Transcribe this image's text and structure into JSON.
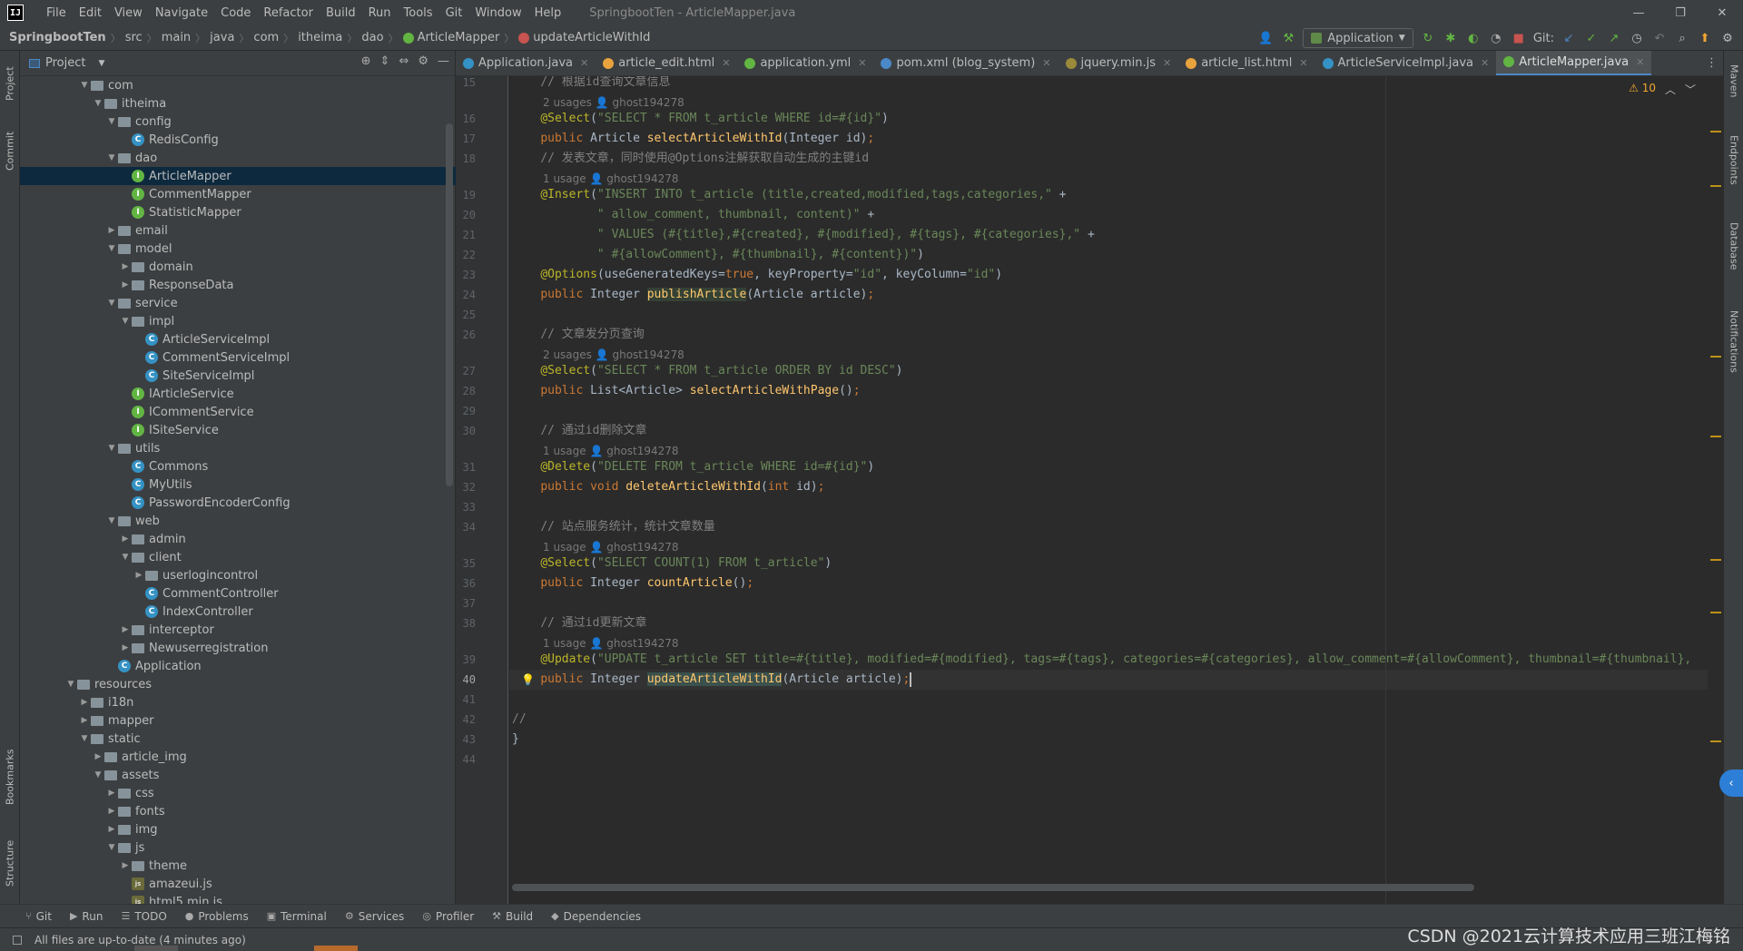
{
  "app": {
    "logo": "IJ",
    "window_title": "SpringbootTen - ArticleMapper.java",
    "menu": [
      "File",
      "Edit",
      "View",
      "Navigate",
      "Code",
      "Refactor",
      "Build",
      "Run",
      "Tools",
      "Git",
      "Window",
      "Help"
    ],
    "window_controls": [
      "—",
      "❐",
      "✕"
    ]
  },
  "navbar": {
    "breadcrumb": [
      "SpringbootTen",
      "src",
      "main",
      "java",
      "com",
      "itheima",
      "dao",
      "ArticleMapper",
      "updateArticleWithId"
    ],
    "run_config": "Application",
    "git_label": "Git:"
  },
  "left_strip": {
    "tabs": [
      "Project",
      "Commit",
      "Bookmarks",
      "Structure"
    ]
  },
  "right_strip": {
    "tabs": [
      "Maven",
      "Endpoints",
      "Database",
      "Notifications"
    ]
  },
  "project_panel": {
    "title": "Project",
    "tree": [
      {
        "depth": 0,
        "label": "com",
        "type": "folder",
        "open": true
      },
      {
        "depth": 1,
        "label": "itheima",
        "type": "folder",
        "open": true
      },
      {
        "depth": 2,
        "label": "config",
        "type": "folder",
        "open": true
      },
      {
        "depth": 3,
        "label": "RedisConfig",
        "type": "class"
      },
      {
        "depth": 2,
        "label": "dao",
        "type": "folder",
        "open": true
      },
      {
        "depth": 3,
        "label": "ArticleMapper",
        "type": "interface",
        "selected": true
      },
      {
        "depth": 3,
        "label": "CommentMapper",
        "type": "interface"
      },
      {
        "depth": 3,
        "label": "StatisticMapper",
        "type": "interface"
      },
      {
        "depth": 2,
        "label": "email",
        "type": "folder",
        "open": false
      },
      {
        "depth": 2,
        "label": "model",
        "type": "folder",
        "open": true
      },
      {
        "depth": 3,
        "label": "domain",
        "type": "folder",
        "open": false
      },
      {
        "depth": 3,
        "label": "ResponseData",
        "type": "folder",
        "open": false
      },
      {
        "depth": 2,
        "label": "service",
        "type": "folder",
        "open": true
      },
      {
        "depth": 3,
        "label": "impl",
        "type": "folder",
        "open": true
      },
      {
        "depth": 4,
        "label": "ArticleServiceImpl",
        "type": "class"
      },
      {
        "depth": 4,
        "label": "CommentServiceImpl",
        "type": "class"
      },
      {
        "depth": 4,
        "label": "SiteServiceImpl",
        "type": "class"
      },
      {
        "depth": 3,
        "label": "IArticleService",
        "type": "interface"
      },
      {
        "depth": 3,
        "label": "ICommentService",
        "type": "interface"
      },
      {
        "depth": 3,
        "label": "ISiteService",
        "type": "interface"
      },
      {
        "depth": 2,
        "label": "utils",
        "type": "folder",
        "open": true
      },
      {
        "depth": 3,
        "label": "Commons",
        "type": "class"
      },
      {
        "depth": 3,
        "label": "MyUtils",
        "type": "class"
      },
      {
        "depth": 3,
        "label": "PasswordEncoderConfig",
        "type": "class"
      },
      {
        "depth": 2,
        "label": "web",
        "type": "folder",
        "open": true
      },
      {
        "depth": 3,
        "label": "admin",
        "type": "folder",
        "open": false
      },
      {
        "depth": 3,
        "label": "client",
        "type": "folder",
        "open": true
      },
      {
        "depth": 4,
        "label": "userlogincontrol",
        "type": "folder",
        "open": false
      },
      {
        "depth": 4,
        "label": "CommentController",
        "type": "class"
      },
      {
        "depth": 4,
        "label": "IndexController",
        "type": "class"
      },
      {
        "depth": 3,
        "label": "interceptor",
        "type": "folder",
        "open": false
      },
      {
        "depth": 3,
        "label": "Newuserregistration",
        "type": "folder",
        "open": false
      },
      {
        "depth": 2,
        "label": "Application",
        "type": "app"
      },
      {
        "depth": -1,
        "label": "resources",
        "type": "folder",
        "open": true
      },
      {
        "depth": 0,
        "label": "i18n",
        "type": "folder",
        "open": false
      },
      {
        "depth": 0,
        "label": "mapper",
        "type": "folder",
        "open": false
      },
      {
        "depth": 0,
        "label": "static",
        "type": "folder",
        "open": true
      },
      {
        "depth": 1,
        "label": "article_img",
        "type": "folder",
        "open": false
      },
      {
        "depth": 1,
        "label": "assets",
        "type": "folder",
        "open": true
      },
      {
        "depth": 2,
        "label": "css",
        "type": "folder",
        "open": false
      },
      {
        "depth": 2,
        "label": "fonts",
        "type": "folder",
        "open": false
      },
      {
        "depth": 2,
        "label": "img",
        "type": "folder",
        "open": false
      },
      {
        "depth": 2,
        "label": "js",
        "type": "folder",
        "open": true
      },
      {
        "depth": 3,
        "label": "theme",
        "type": "folder",
        "open": false
      },
      {
        "depth": 3,
        "label": "amazeui.js",
        "type": "js"
      },
      {
        "depth": 3,
        "label": "html5.min.js",
        "type": "js"
      }
    ]
  },
  "editor_tabs": [
    {
      "label": "Application.java",
      "color": "#3592c4",
      "active": false
    },
    {
      "label": "article_edit.html",
      "color": "#e8a33d",
      "active": false
    },
    {
      "label": "application.yml",
      "color": "#62b543",
      "active": false
    },
    {
      "label": "pom.xml (blog_system)",
      "color": "#4a88c7",
      "active": false
    },
    {
      "label": "jquery.min.js",
      "color": "#9a8a3a",
      "active": false
    },
    {
      "label": "article_list.html",
      "color": "#e8a33d",
      "active": false
    },
    {
      "label": "ArticleServiceImpl.java",
      "color": "#3592c4",
      "active": false
    },
    {
      "label": "ArticleMapper.java",
      "color": "#62b543",
      "active": true
    }
  ],
  "editor": {
    "warnings": "⚠ 10",
    "current_line": 40,
    "lines": [
      {
        "n": 15,
        "html": "    <span class=\"c\">// 根据id查询文章信息</span>"
      },
      {
        "hint": "2 usages   👤 ghost194278"
      },
      {
        "n": 16,
        "html": "    <span class=\"an\">@Select</span>(<span class=\"s\">\"SELECT * FROM t_article WHERE id=#{id}\"</span>)"
      },
      {
        "n": 17,
        "html": "    <span class=\"k\">public</span> Article <span class=\"fn\">selectArticleWithId</span>(Integer id)<span class=\"k\">;</span>"
      },
      {
        "n": 18,
        "html": "    <span class=\"c\">// 发表文章，同时使用@Options注解获取自动生成的主键id</span>"
      },
      {
        "hint": "1 usage   👤 ghost194278"
      },
      {
        "n": 19,
        "html": "    <span class=\"an\">@Insert</span>(<span class=\"s\">\"INSERT INTO t_article (title,created,modified,tags,categories,\"</span> +"
      },
      {
        "n": 20,
        "html": "            <span class=\"s\">\" allow_comment, thumbnail, content)\"</span> +"
      },
      {
        "n": 21,
        "html": "            <span class=\"s\">\" VALUES (#{title},#{created}, #{modified}, #{tags}, #{categories},\"</span> +"
      },
      {
        "n": 22,
        "html": "            <span class=\"s\">\" #{allowComment}, #{thumbnail}, #{content})\"</span>)"
      },
      {
        "n": 23,
        "html": "    <span class=\"an\">@Options</span>(useGeneratedKeys=<span class=\"k\">true</span>, keyProperty=<span class=\"s\">\"id\"</span>, keyColumn=<span class=\"s\">\"id\"</span>)"
      },
      {
        "n": 24,
        "html": "    <span class=\"k\">public</span> Integer <span class=\"fn hl\">publishArticle</span>(Article article)<span class=\"k\">;</span>"
      },
      {
        "n": 25,
        "html": ""
      },
      {
        "n": 26,
        "html": "    <span class=\"c\">// 文章发分页查询</span>"
      },
      {
        "hint": "2 usages   👤 ghost194278"
      },
      {
        "n": 27,
        "html": "    <span class=\"an\">@Select</span>(<span class=\"s\">\"SELECT * FROM t_article ORDER BY id DESC\"</span>)"
      },
      {
        "n": 28,
        "html": "    <span class=\"k\">public</span> List&lt;Article&gt; <span class=\"fn\">selectArticleWithPage</span>()<span class=\"k\">;</span>"
      },
      {
        "n": 29,
        "html": ""
      },
      {
        "n": 30,
        "html": "    <span class=\"c\">// 通过id删除文章</span>"
      },
      {
        "hint": "1 usage   👤 ghost194278"
      },
      {
        "n": 31,
        "html": "    <span class=\"an\">@Delete</span>(<span class=\"s\">\"DELETE FROM t_article WHERE id=#{id}\"</span>)"
      },
      {
        "n": 32,
        "html": "    <span class=\"k\">public void</span> <span class=\"fn\">deleteArticleWithId</span>(<span class=\"k\">int</span> id)<span class=\"k\">;</span>"
      },
      {
        "n": 33,
        "html": ""
      },
      {
        "n": 34,
        "html": "    <span class=\"c\">// 站点服务统计，统计文章数量</span>"
      },
      {
        "hint": "1 usage   👤 ghost194278"
      },
      {
        "n": 35,
        "html": "    <span class=\"an\">@Select</span>(<span class=\"s\">\"SELECT COUNT(1) FROM t_article\"</span>)"
      },
      {
        "n": 36,
        "html": "    <span class=\"k\">public</span> Integer <span class=\"fn\">countArticle</span>()<span class=\"k\">;</span>"
      },
      {
        "n": 37,
        "html": ""
      },
      {
        "n": 38,
        "html": "    <span class=\"c\">// 通过id更新文章</span>"
      },
      {
        "hint": "1 usage   👤 ghost194278"
      },
      {
        "n": 39,
        "html": "    <span class=\"an\">@Update</span>(<span class=\"s\">\"UPDATE t_article SET title=#{title}, modified=#{modified}, tags=#{tags}, categories=#{categories}, allow_comment=#{allowComment}, thumbnail=#{thumbnail},</span>"
      },
      {
        "n": 40,
        "html": "    <span class=\"k\">public</span> Integer <span class=\"fn hl2\">updateArticleWithId</span>(Article article)<span class=\"k\">;</span><span class=\"cursor\"></span>"
      },
      {
        "n": 41,
        "html": ""
      },
      {
        "n": 42,
        "html": "<span class=\"c\">//</span>"
      },
      {
        "n": 43,
        "html": "}"
      },
      {
        "n": 44,
        "html": ""
      }
    ]
  },
  "bottom_tools": [
    "Git",
    "Run",
    "TODO",
    "Problems",
    "Terminal",
    "Services",
    "Profiler",
    "Build",
    "Dependencies"
  ],
  "bottom_icons": [
    "⑂",
    "▶",
    "☰",
    "●",
    "▣",
    "⚙",
    "◎",
    "⚒",
    "◆"
  ],
  "status": {
    "message": "All files are up-to-date (4 minutes ago)",
    "watermark": "CSDN @2021云计算技术应用三班江梅铭"
  },
  "colors": {
    "accent": "#4a88c7",
    "selection": "#0d293e",
    "warning": "#f0a732"
  }
}
